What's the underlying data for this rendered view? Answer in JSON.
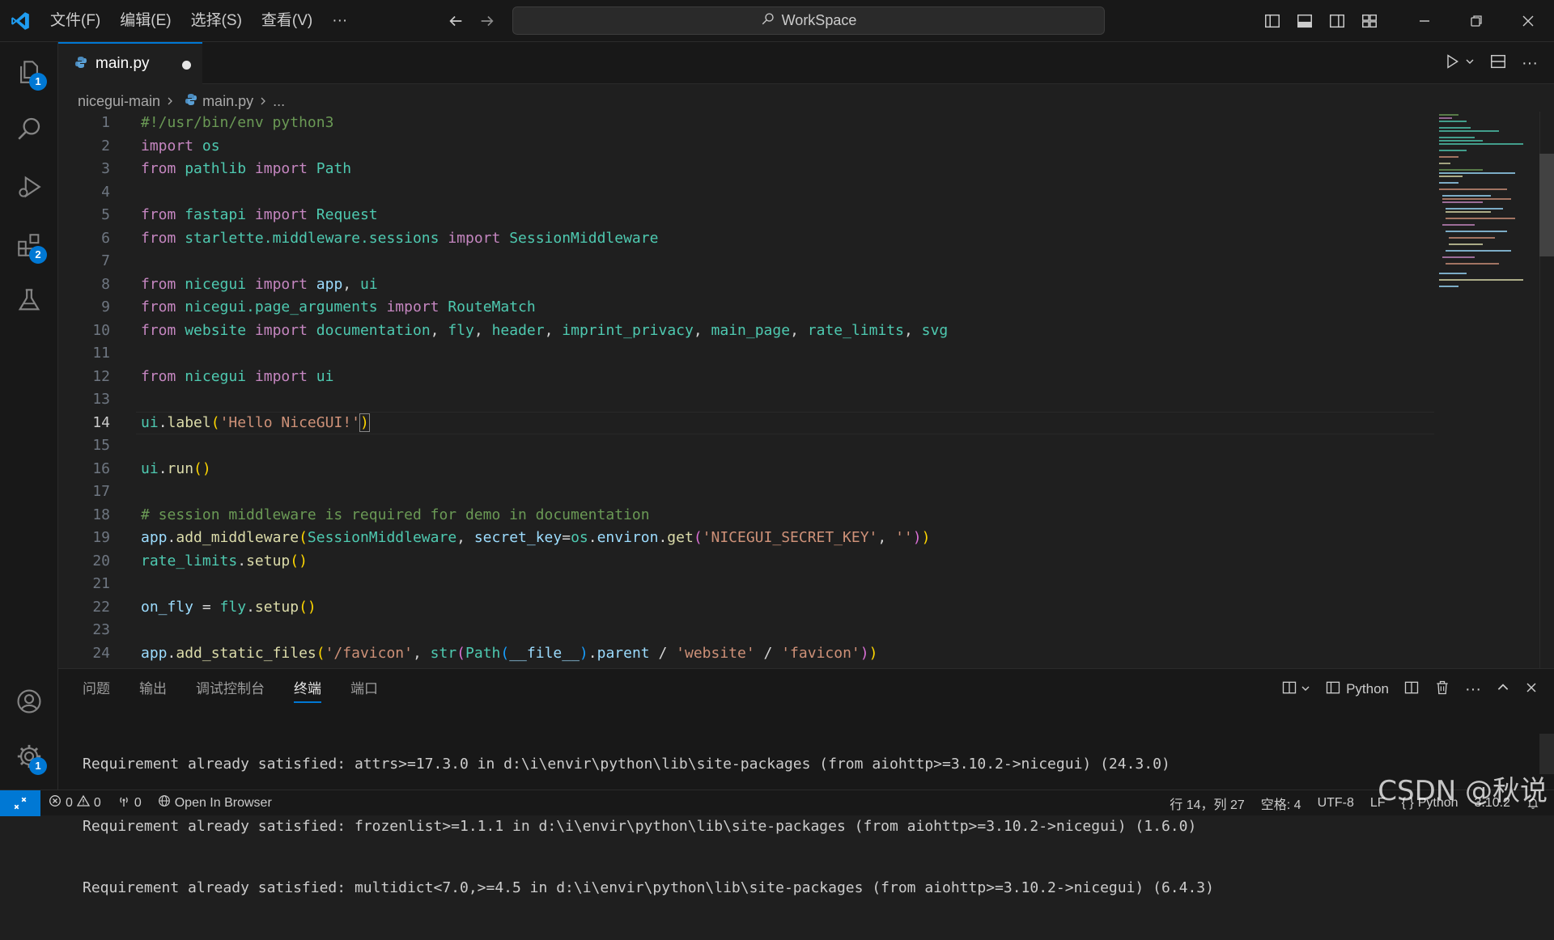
{
  "menu": {
    "items": [
      "文件(F)",
      "编辑(E)",
      "选择(S)",
      "查看(V)",
      "···"
    ]
  },
  "search": {
    "label": "WorkSpace"
  },
  "activity": {
    "explorer_badge": "1",
    "extensions_badge": "2",
    "settings_badge": "1"
  },
  "tab": {
    "label": "main.py"
  },
  "breadcrumb": {
    "folder": "nicegui-main",
    "file": "main.py",
    "more": "..."
  },
  "editor": {
    "active_line": 14,
    "lines": [
      [
        [
          "c",
          "#!/usr/bin/env python3"
        ]
      ],
      [
        [
          "k",
          "import"
        ],
        [
          "p",
          " "
        ],
        [
          "cl",
          "os"
        ]
      ],
      [
        [
          "k",
          "from"
        ],
        [
          "p",
          " "
        ],
        [
          "cl",
          "pathlib"
        ],
        [
          "p",
          " "
        ],
        [
          "k",
          "import"
        ],
        [
          "p",
          " "
        ],
        [
          "cl",
          "Path"
        ]
      ],
      [],
      [
        [
          "k",
          "from"
        ],
        [
          "p",
          " "
        ],
        [
          "cl",
          "fastapi"
        ],
        [
          "p",
          " "
        ],
        [
          "k",
          "import"
        ],
        [
          "p",
          " "
        ],
        [
          "cl",
          "Request"
        ]
      ],
      [
        [
          "k",
          "from"
        ],
        [
          "p",
          " "
        ],
        [
          "cl",
          "starlette.middleware.sessions"
        ],
        [
          "p",
          " "
        ],
        [
          "k",
          "import"
        ],
        [
          "p",
          " "
        ],
        [
          "cl",
          "SessionMiddleware"
        ]
      ],
      [],
      [
        [
          "k",
          "from"
        ],
        [
          "p",
          " "
        ],
        [
          "cl",
          "nicegui"
        ],
        [
          "p",
          " "
        ],
        [
          "k",
          "import"
        ],
        [
          "p",
          " "
        ],
        [
          "i",
          "app"
        ],
        [
          "p",
          ", "
        ],
        [
          "cl",
          "ui"
        ]
      ],
      [
        [
          "k",
          "from"
        ],
        [
          "p",
          " "
        ],
        [
          "cl",
          "nicegui.page_arguments"
        ],
        [
          "p",
          " "
        ],
        [
          "k",
          "import"
        ],
        [
          "p",
          " "
        ],
        [
          "cl",
          "RouteMatch"
        ]
      ],
      [
        [
          "k",
          "from"
        ],
        [
          "p",
          " "
        ],
        [
          "cl",
          "website"
        ],
        [
          "p",
          " "
        ],
        [
          "k",
          "import"
        ],
        [
          "p",
          " "
        ],
        [
          "cl",
          "documentation"
        ],
        [
          "p",
          ", "
        ],
        [
          "cl",
          "fly"
        ],
        [
          "p",
          ", "
        ],
        [
          "cl",
          "header"
        ],
        [
          "p",
          ", "
        ],
        [
          "cl",
          "imprint_privacy"
        ],
        [
          "p",
          ", "
        ],
        [
          "cl",
          "main_page"
        ],
        [
          "p",
          ", "
        ],
        [
          "cl",
          "rate_limits"
        ],
        [
          "p",
          ", "
        ],
        [
          "cl",
          "svg"
        ]
      ],
      [],
      [
        [
          "k",
          "from"
        ],
        [
          "p",
          " "
        ],
        [
          "cl",
          "nicegui"
        ],
        [
          "p",
          " "
        ],
        [
          "k",
          "import"
        ],
        [
          "p",
          " "
        ],
        [
          "cl",
          "ui"
        ]
      ],
      [],
      [
        [
          "cl",
          "ui"
        ],
        [
          "p",
          "."
        ],
        [
          "f",
          "label"
        ],
        [
          "b1",
          "("
        ],
        [
          "s",
          "'Hello NiceGUI!'"
        ],
        [
          "b1",
          ")"
        ]
      ],
      [],
      [
        [
          "cl",
          "ui"
        ],
        [
          "p",
          "."
        ],
        [
          "f",
          "run"
        ],
        [
          "b1",
          "()"
        ]
      ],
      [],
      [
        [
          "c",
          "# session middleware is required for demo in documentation"
        ]
      ],
      [
        [
          "i",
          "app"
        ],
        [
          "p",
          "."
        ],
        [
          "f",
          "add_middleware"
        ],
        [
          "b1",
          "("
        ],
        [
          "cl",
          "SessionMiddleware"
        ],
        [
          "p",
          ", "
        ],
        [
          "i",
          "secret_key"
        ],
        [
          "p",
          "="
        ],
        [
          "cl",
          "os"
        ],
        [
          "p",
          "."
        ],
        [
          "i",
          "environ"
        ],
        [
          "p",
          "."
        ],
        [
          "f",
          "get"
        ],
        [
          "b2",
          "("
        ],
        [
          "s",
          "'NICEGUI_SECRET_KEY'"
        ],
        [
          "p",
          ", "
        ],
        [
          "s",
          "''"
        ],
        [
          "b2",
          ")"
        ],
        [
          "b1",
          ")"
        ]
      ],
      [
        [
          "cl",
          "rate_limits"
        ],
        [
          "p",
          "."
        ],
        [
          "f",
          "setup"
        ],
        [
          "b1",
          "()"
        ]
      ],
      [],
      [
        [
          "i",
          "on_fly"
        ],
        [
          "p",
          " = "
        ],
        [
          "cl",
          "fly"
        ],
        [
          "p",
          "."
        ],
        [
          "f",
          "setup"
        ],
        [
          "b1",
          "()"
        ]
      ],
      [],
      [
        [
          "i",
          "app"
        ],
        [
          "p",
          "."
        ],
        [
          "f",
          "add_static_files"
        ],
        [
          "b1",
          "("
        ],
        [
          "s",
          "'/favicon'"
        ],
        [
          "p",
          ", "
        ],
        [
          "cl",
          "str"
        ],
        [
          "b2",
          "("
        ],
        [
          "cl",
          "Path"
        ],
        [
          "b3",
          "("
        ],
        [
          "i",
          "__file__"
        ],
        [
          "b3",
          ")"
        ],
        [
          "p",
          "."
        ],
        [
          "i",
          "parent"
        ],
        [
          "p",
          " / "
        ],
        [
          "s",
          "'website'"
        ],
        [
          "p",
          " / "
        ],
        [
          "s",
          "'favicon'"
        ],
        [
          "b2",
          ")"
        ],
        [
          "b1",
          ")"
        ]
      ]
    ]
  },
  "panel": {
    "tabs": [
      "问题",
      "输出",
      "调试控制台",
      "终端",
      "端口"
    ],
    "active_tab": "终端",
    "terminal_name": "Python",
    "terminal_lines": [
      "Requirement already satisfied: attrs>=17.3.0 in d:\\i\\envir\\python\\lib\\site-packages (from aiohttp>=3.10.2->nicegui) (24.3.0)",
      "Requirement already satisfied: frozenlist>=1.1.1 in d:\\i\\envir\\python\\lib\\site-packages (from aiohttp>=3.10.2->nicegui) (1.6.0)",
      "Requirement already satisfied: multidict<7.0,>=4.5 in d:\\i\\envir\\python\\lib\\site-packages (from aiohttp>=3.10.2->nicegui) (6.4.3)"
    ]
  },
  "status": {
    "errors": "0",
    "warnings": "0",
    "ports": "0",
    "open_browser": "Open In Browser",
    "cursor_pos": "行 14，列 27",
    "spaces": "空格: 4",
    "encoding": "UTF-8",
    "eol": "LF",
    "language": "Python",
    "python_version": "3.10.2"
  },
  "watermark": "CSDN @秋说",
  "colors": {
    "accent": "#0078d4",
    "background": "#1f1f1f"
  }
}
